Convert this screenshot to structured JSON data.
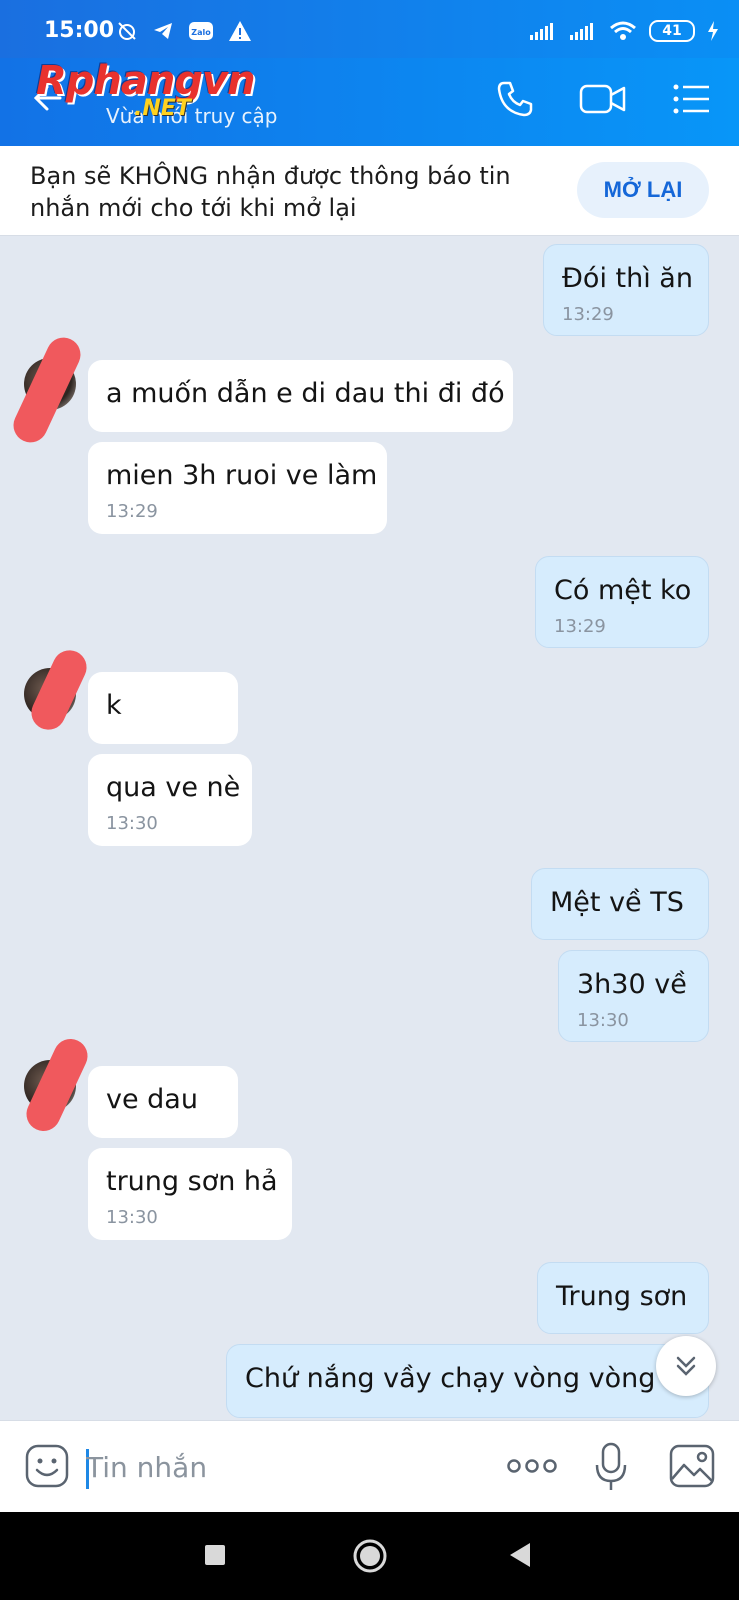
{
  "status_bar": {
    "time": "15:00",
    "battery": "41"
  },
  "header": {
    "watermark_main": "Rphangvn",
    "watermark_net": ".NET",
    "subtitle": "Vừa mới truy cập"
  },
  "notice": {
    "text": "Bạn sẽ KHÔNG nhận được thông báo tin nhắn mới cho tới khi mở lại",
    "button": "MỞ LẠI"
  },
  "messages": [
    {
      "dir": "out",
      "text": "Đói thì ăn",
      "time": "13:29"
    },
    {
      "dir": "in",
      "text": "a muốn dẫn e di dau thi đi đó",
      "time": ""
    },
    {
      "dir": "in",
      "text": "mien 3h ruoi ve làm",
      "time": "13:29"
    },
    {
      "dir": "out",
      "text": "Có mệt ko",
      "time": "13:29"
    },
    {
      "dir": "in",
      "text": "k",
      "time": ""
    },
    {
      "dir": "in",
      "text": "qua ve nè",
      "time": "13:30"
    },
    {
      "dir": "out",
      "text": "Mệt về TS",
      "time": ""
    },
    {
      "dir": "out",
      "text": "3h30 về",
      "time": "13:30"
    },
    {
      "dir": "in",
      "text": "ve dau",
      "time": ""
    },
    {
      "dir": "in",
      "text": "trung sơn hả",
      "time": "13:30"
    },
    {
      "dir": "out",
      "text": "Trung sơn",
      "time": ""
    },
    {
      "dir": "out",
      "text": "Chứ nắng vầy chạy vòng vòng c",
      "time": ""
    }
  ],
  "input": {
    "placeholder": "Tin nhắn"
  },
  "icons": {
    "back": "back-arrow-icon",
    "call": "phone-icon",
    "video": "video-camera-icon",
    "menu": "menu-icon",
    "emoji": "emoji-icon",
    "more": "more-dots-icon",
    "mic": "microphone-icon",
    "image": "image-icon",
    "scroll": "chevron-double-down-icon"
  },
  "colors": {
    "header": "#0a8ff5",
    "outgoing_bubble": "#d6ecfd",
    "incoming_bubble": "#ffffff",
    "chat_bg": "#e2e8f1",
    "accent": "#1567d8"
  }
}
